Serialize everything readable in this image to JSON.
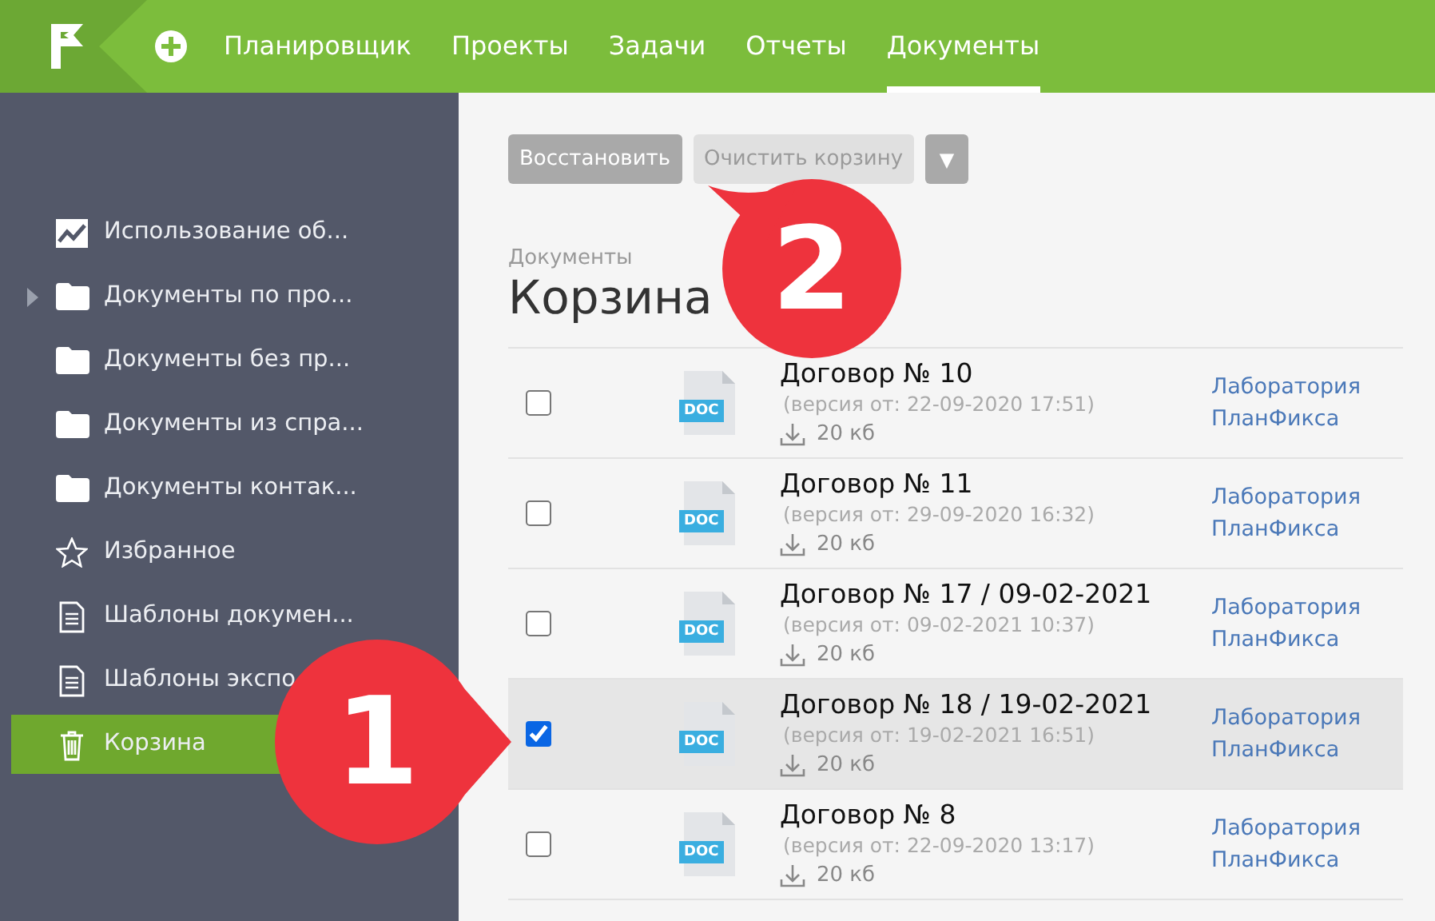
{
  "topbar": {
    "nav": [
      {
        "label": "Планировщик",
        "selected": false
      },
      {
        "label": "Проекты",
        "selected": false
      },
      {
        "label": "Задачи",
        "selected": false
      },
      {
        "label": "Отчеты",
        "selected": false
      },
      {
        "label": "Документы",
        "selected": true
      }
    ]
  },
  "sidebar": {
    "items": [
      {
        "label": "Использование об...",
        "kind": "chart",
        "expandable": false,
        "selected": false
      },
      {
        "label": "Документы по про...",
        "kind": "folder",
        "expandable": true,
        "selected": false
      },
      {
        "label": "Документы без пр...",
        "kind": "folder",
        "expandable": false,
        "selected": false
      },
      {
        "label": "Документы из спра...",
        "kind": "folder",
        "expandable": false,
        "selected": false
      },
      {
        "label": "Документы контак...",
        "kind": "folder",
        "expandable": false,
        "selected": false
      },
      {
        "label": "Избранное",
        "kind": "star",
        "expandable": false,
        "selected": false
      },
      {
        "label": "Шаблоны докумен...",
        "kind": "document",
        "expandable": false,
        "selected": false
      },
      {
        "label": "Шаблоны экспо",
        "kind": "document",
        "expandable": false,
        "selected": false
      },
      {
        "label": "Корзина",
        "kind": "trash",
        "expandable": false,
        "selected": true
      }
    ]
  },
  "toolbar": {
    "buttons": [
      {
        "label": "Восстановить",
        "disabled": false
      },
      {
        "label": "Очистить корзину",
        "disabled": true
      }
    ],
    "menu_button": "▼"
  },
  "breadcrumb": "Документы",
  "title": "Корзина",
  "rows": [
    {
      "title": "Договор № 10",
      "version": "(версия от: 22-09-2020 17:51)",
      "size": "20 кб",
      "file_type": "DOC",
      "owner": "Лаборатория ПланФикса",
      "checked": false,
      "selected": false
    },
    {
      "title": "Договор № 11",
      "version": "(версия от: 29-09-2020 16:32)",
      "size": "20 кб",
      "file_type": "DOC",
      "owner": "Лаборатория ПланФикса",
      "checked": false,
      "selected": false
    },
    {
      "title": "Договор № 17 / 09-02-2021",
      "version": "(версия от: 09-02-2021 10:37)",
      "size": "20 кб",
      "file_type": "DOC",
      "owner": "Лаборатория ПланФикса",
      "checked": false,
      "selected": false
    },
    {
      "title": "Договор № 18 / 19-02-2021",
      "version": "(версия от: 19-02-2021 16:51)",
      "size": "20 кб",
      "file_type": "DOC",
      "owner": "Лаборатория ПланФикса",
      "checked": true,
      "selected": true
    },
    {
      "title": "Договор № 8",
      "version": "(версия от: 22-09-2020 13:17)",
      "size": "20 кб",
      "file_type": "DOC",
      "owner": "Лаборатория ПланФикса",
      "checked": false,
      "selected": false
    }
  ],
  "callouts": [
    {
      "number": "1"
    },
    {
      "number": "2"
    }
  ]
}
